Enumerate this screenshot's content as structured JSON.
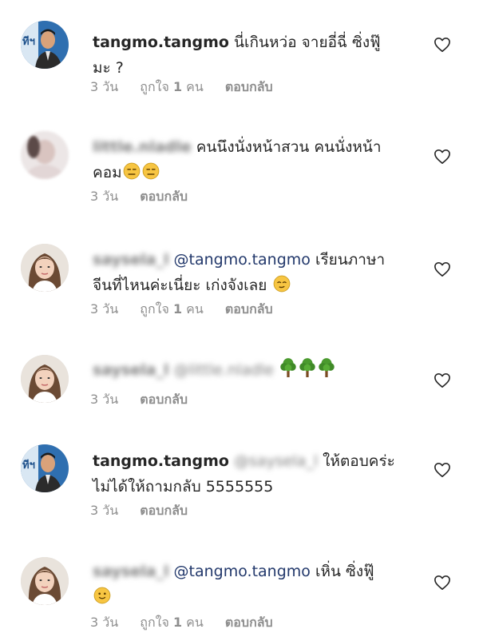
{
  "comments": [
    {
      "username": "tangmo.tangmo",
      "mention": "",
      "line1": "นี่เกินหว่อ จายอี่ฉี่ ซิ่งฟู๊",
      "line2": "มะ ?",
      "time": "3 วัน",
      "likes_label": "ถูกใจ",
      "likes_count": "1",
      "likes_unit": "คน",
      "reply": "ตอบกลับ",
      "avatar": "man-avatar"
    },
    {
      "username": "little.nladle",
      "mention": "",
      "line1": "คนนึงนั่งหน้าสวน คนนั่งหน้า",
      "line2": "คอม",
      "time": "3 วัน",
      "reply": "ตอบกลับ",
      "emojis": [
        "expressionless-face-emoji",
        "expressionless-face-emoji"
      ],
      "avatar": "blurred-avatar"
    },
    {
      "username": "saysela_l",
      "mention": "@tangmo.tangmo",
      "line1": "เรียนภาษา",
      "line2": "จีนที่ไหนค่ะเนี่ยะ เก่งจังเลย",
      "time": "3 วัน",
      "likes_label": "ถูกใจ",
      "likes_count": "1",
      "likes_unit": "คน",
      "reply": "ตอบกลับ",
      "emojis": [
        "relieved-face-emoji"
      ],
      "avatar": "woman-avatar"
    },
    {
      "username": "saysela_l",
      "mention": "@little.nladle",
      "line1": "",
      "line2": "",
      "time": "3 วัน",
      "reply": "ตอบกลับ",
      "emojis": [
        "tree-emoji",
        "tree-emoji",
        "tree-emoji"
      ],
      "avatar": "woman-avatar"
    },
    {
      "username": "tangmo.tangmo",
      "mention": "@saysela_l",
      "line1": "ให้ตอบคร่ะ",
      "line2": "ไม่ได้ให้ถามกลับ 5555555",
      "time": "3 วัน",
      "reply": "ตอบกลับ",
      "avatar": "man-avatar"
    },
    {
      "username": "saysela_l",
      "mention": "@tangmo.tangmo",
      "line1": "เหิ่น ซิ่งฟู๊",
      "line2": "",
      "time": "3 วัน",
      "likes_label": "ถูกใจ",
      "likes_count": "1",
      "likes_unit": "คน",
      "reply": "ตอบกลับ",
      "emojis": [
        "slightly-smiling-face-emoji"
      ],
      "avatar": "woman-avatar"
    }
  ],
  "icons": {
    "like": "heart-outline-icon"
  },
  "colors": {
    "text": "#262626",
    "meta": "#8e8e8e",
    "mention": "#22386b",
    "emoji_face": "#f7c542",
    "tree_leaf": "#4a9a2e"
  }
}
